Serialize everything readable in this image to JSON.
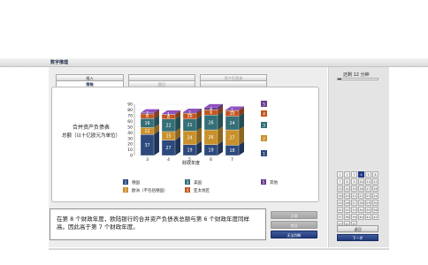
{
  "window": {
    "title": "数字推理"
  },
  "tabs": [
    {
      "label": "插入"
    },
    {
      "label": ""
    },
    {
      "label": "资产负债表"
    },
    {
      "label": "策略"
    },
    {
      "label": "题目"
    },
    {
      "label": ""
    }
  ],
  "chart_data": {
    "type": "bar",
    "stacked": true,
    "orientation": "vertical",
    "style": "3d",
    "title": "合并资产负债表",
    "subtitle": "总额（以十亿欧元为单位）",
    "xlabel": "财政年度",
    "categories": [
      "3",
      "4",
      "5",
      "6",
      "7"
    ],
    "ylim": [
      0,
      90
    ],
    "yticks": [
      "0",
      "10",
      "20",
      "30",
      "40",
      "50",
      "60",
      "70",
      "80",
      "90"
    ],
    "legend_position": "right",
    "series": [
      {
        "name": "德国",
        "marker": "1",
        "color": "#2e4a7d",
        "values": [
          37,
          27,
          19,
          19,
          18
        ]
      },
      {
        "name": "欧洲（不包括德国）",
        "marker": "2",
        "color": "#c9912c",
        "values": [
          12,
          15,
          24,
          26,
          27
        ]
      },
      {
        "name": "美国",
        "marker": "3",
        "color": "#356f78",
        "values": [
          16,
          22,
          21,
          26,
          24
        ]
      },
      {
        "name": "亚太地区",
        "marker": "4",
        "color": "#c2561f",
        "values": [
          8,
          8,
          10,
          9,
          10
        ]
      },
      {
        "name": "其他",
        "marker": "5",
        "color": "#6a3c8c",
        "values": [
          2,
          1,
          2,
          4,
          1
        ]
      }
    ]
  },
  "question": {
    "text": "在第 8 个财政年度，欧陆银行的合并资产负债表总额与第 6 个财政年度同样高。因此高于第 7 个财政年度。"
  },
  "answers": [
    {
      "label": "正确",
      "state": "disabled"
    },
    {
      "label": "错误",
      "state": "disabled"
    },
    {
      "label": "无法判断",
      "state": "selected"
    }
  ],
  "sidebar": {
    "timer_label": "还剩 12 分钟",
    "progress": 0.08,
    "current_question": 4,
    "question_count": 45,
    "prev_label": "返回",
    "next_label": "下一步"
  },
  "colors": {
    "accent": "#22397a",
    "panel_bg": "#ededed"
  }
}
